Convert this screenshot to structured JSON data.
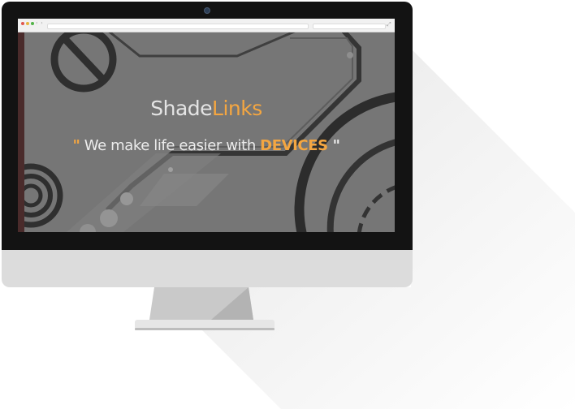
{
  "browser": {
    "nav_arrows": "‹ ›",
    "resize_icon": "⤢"
  },
  "hero": {
    "brand_part1": "Shade",
    "brand_part2": "Links",
    "tagline_open_quote": "\"",
    "tagline_text": " We make life easier with ",
    "tagline_highlight": "DEVICES",
    "tagline_close_quote": " \""
  },
  "colors": {
    "accent": "#f4a641",
    "bezel": "#131313",
    "chin": "#dcdcdc",
    "screen_bg": "#7c7c7c"
  }
}
